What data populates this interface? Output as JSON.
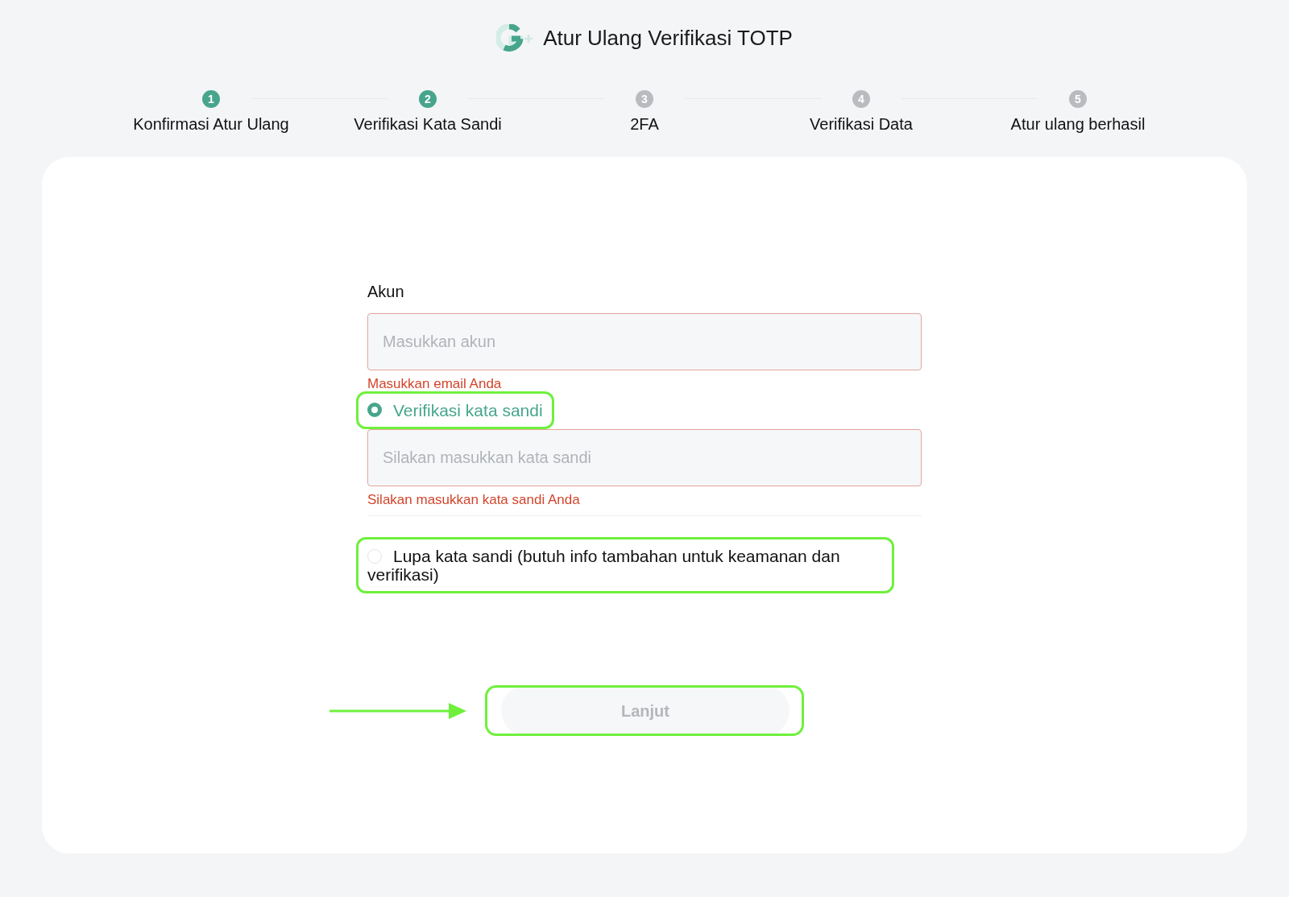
{
  "header": {
    "title": "Atur Ulang Verifikasi TOTP"
  },
  "steps": [
    {
      "number": "1",
      "label": "Konfirmasi Atur Ulang",
      "active": true
    },
    {
      "number": "2",
      "label": "Verifikasi Kata Sandi",
      "active": true
    },
    {
      "number": "3",
      "label": "2FA",
      "active": false
    },
    {
      "number": "4",
      "label": "Verifikasi Data",
      "active": false
    },
    {
      "number": "5",
      "label": "Atur ulang berhasil",
      "active": false
    }
  ],
  "form": {
    "account_label": "Akun",
    "account_placeholder": "Masukkan akun",
    "account_error": "Masukkan email Anda",
    "options": [
      {
        "label": "Verifikasi kata sandi",
        "selected": true,
        "highlighted": true
      },
      {
        "label": "Lupa kata sandi (butuh info tambahan untuk keamanan dan verifikasi)",
        "selected": false,
        "highlighted": true
      }
    ],
    "password_placeholder": "Silakan masukkan kata sandi",
    "password_error": "Silakan masukkan kata sandi Anda",
    "submit": {
      "label": "Lanjut",
      "disabled": true,
      "highlighted": true
    }
  }
}
